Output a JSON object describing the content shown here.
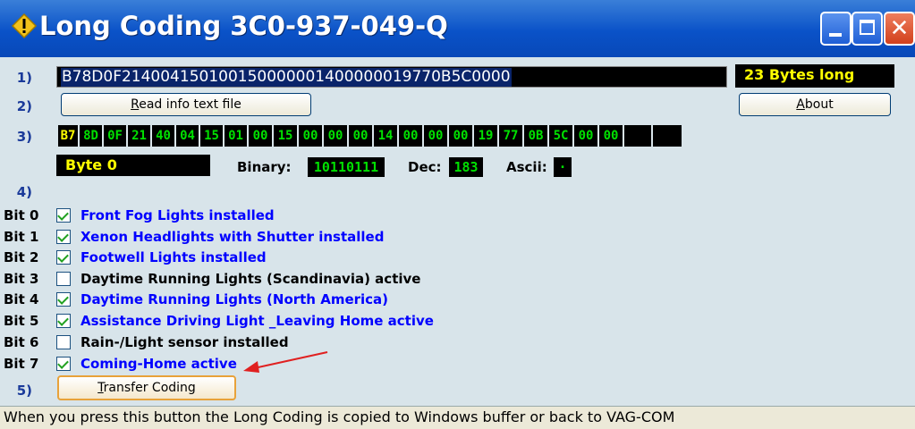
{
  "window": {
    "title": "Long Coding 3C0-937-049-Q",
    "icon": "vag-com-info-icon"
  },
  "steps": {
    "s1": "1)",
    "s2": "2)",
    "s3": "3)",
    "s4": "4)",
    "s5": "5)"
  },
  "coding": {
    "value": "B78D0F214004150100150000001400000019770B5C0000",
    "length_label": "23 Bytes long"
  },
  "buttons": {
    "read_info": "Read info text file",
    "about": "About",
    "transfer": "Transfer Coding"
  },
  "bytes": [
    "B7",
    "8D",
    "0F",
    "21",
    "40",
    "04",
    "15",
    "01",
    "00",
    "15",
    "00",
    "00",
    "00",
    "14",
    "00",
    "00",
    "00",
    "19",
    "77",
    "0B",
    "5C",
    "00",
    "00",
    "",
    ""
  ],
  "selected_byte_index": 0,
  "byte_info": {
    "label": "Byte 0",
    "binary_label": "Binary:",
    "binary": "10110111",
    "dec_label": "Dec:",
    "dec": "183",
    "ascii_label": "Ascii:",
    "ascii": "·"
  },
  "bits": [
    {
      "bit": "Bit 0",
      "checked": true,
      "text": "Front Fog Lights installed"
    },
    {
      "bit": "Bit 1",
      "checked": true,
      "text": "Xenon Headlights with Shutter installed"
    },
    {
      "bit": "Bit 2",
      "checked": true,
      "text": "Footwell Lights installed"
    },
    {
      "bit": "Bit 3",
      "checked": false,
      "text": "Daytime Running Lights (Scandinavia) active"
    },
    {
      "bit": "Bit 4",
      "checked": true,
      "text": "Daytime Running Lights (North America)"
    },
    {
      "bit": "Bit 5",
      "checked": true,
      "text": "Assistance Driving Light _Leaving Home active"
    },
    {
      "bit": "Bit 6",
      "checked": false,
      "text": "Rain-/Light sensor installed"
    },
    {
      "bit": "Bit 7",
      "checked": true,
      "text": "Coming-Home active"
    }
  ],
  "status": "When you press this button the Long Coding is copied to Windows buffer or back to VAG-COM",
  "colors": {
    "checked_text": "#0000ff",
    "unchecked_text": "#000000",
    "byte_text": "#00e000",
    "selected_byte_text": "#ffff00",
    "annotation_arrow": "#e02020"
  }
}
